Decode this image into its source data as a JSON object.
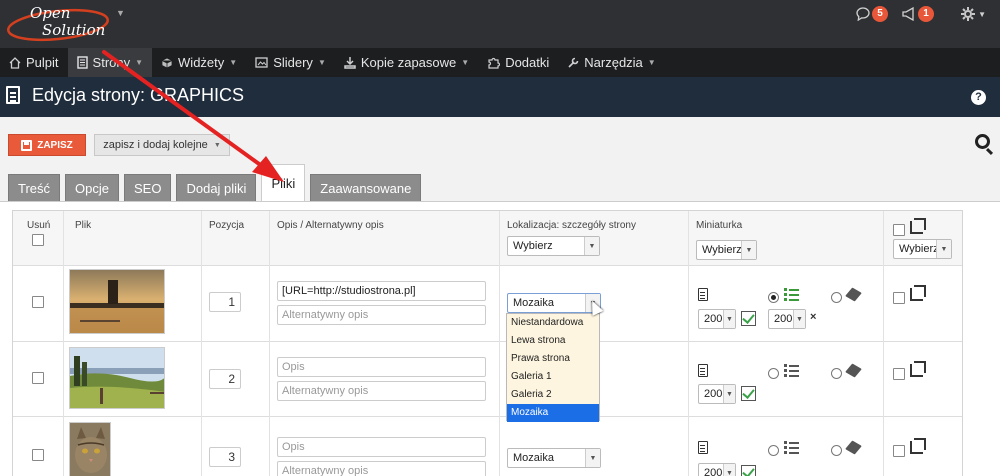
{
  "topbar": {
    "logo_line1": "Open",
    "logo_line2": "Solution",
    "comments_count": "5",
    "notifications_count": "1"
  },
  "menu": [
    {
      "label": "Pulpit",
      "icon": "home-icon"
    },
    {
      "label": "Strony",
      "icon": "page-icon",
      "active": true
    },
    {
      "label": "Widżety",
      "icon": "cube-icon"
    },
    {
      "label": "Slidery",
      "icon": "slides-icon"
    },
    {
      "label": "Kopie zapasowe",
      "icon": "download-icon"
    },
    {
      "label": "Dodatki",
      "icon": "puzzle-icon"
    },
    {
      "label": "Narzędzia",
      "icon": "wrench-icon"
    }
  ],
  "page": {
    "title": "Edycja strony: GRAPHICS",
    "help": "?"
  },
  "actions": {
    "save_label": "ZAPISZ",
    "save_add_label": "zapisz i dodaj kolejne"
  },
  "tabs": [
    "Treść",
    "Opcje",
    "SEO",
    "Dodaj pliki",
    "Pliki",
    "Zaawansowane"
  ],
  "table": {
    "headers": {
      "delete": "Usuń",
      "file": "Plik",
      "position": "Pozycja",
      "description": "Opis / Alternatywny opis",
      "location": "Lokalizacja: szczegóły strony",
      "thumbnail": "Miniaturka"
    },
    "location_select": "Wybierz",
    "thumb_select": "Wybierz",
    "crop_select": "Wybierz",
    "rows": [
      {
        "position": "1",
        "description": "[URL=http://studiostrona.pl]",
        "alt_placeholder": "Alternatywny opis",
        "location": "Mozaika",
        "size1": "200",
        "size2": "200",
        "x": "×"
      },
      {
        "position": "2",
        "description_placeholder": "Opis",
        "alt_placeholder": "Alternatywny opis",
        "size1": "200"
      },
      {
        "position": "3",
        "description_placeholder": "Opis",
        "alt_placeholder": "Alternatywny opis",
        "location": "Mozaika",
        "size1": "200"
      }
    ]
  },
  "dropdown": {
    "options": [
      "Niestandardowa",
      "Lewa strona",
      "Prawa strona",
      "Galeria 1",
      "Galeria 2",
      "Mozaika"
    ],
    "selected": "Mozaika"
  },
  "colors": {
    "save_button": "#e85a3a",
    "annotation_arrow": "#e52222",
    "title_bar": "#1f2d3d",
    "badge": "#e8573a"
  }
}
